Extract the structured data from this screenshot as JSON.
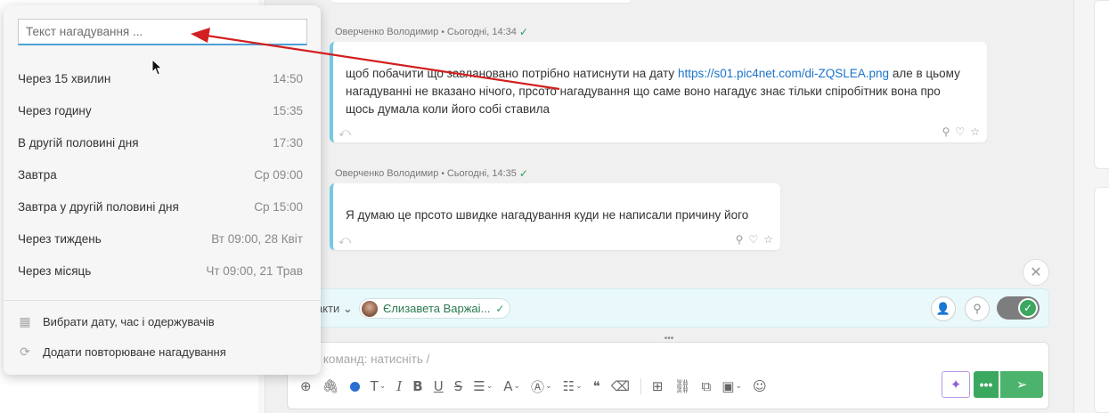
{
  "reminder_popup": {
    "input_placeholder": "Текст нагадування ...",
    "options": [
      {
        "label": "Через 15 хвилин",
        "time": "14:50"
      },
      {
        "label": "Через годину",
        "time": "15:35"
      },
      {
        "label": "В другій половині дня",
        "time": "17:30"
      },
      {
        "label": "Завтра",
        "time": "Ср 09:00"
      },
      {
        "label": "Завтра у другій половині дня",
        "time": "Ср 15:00"
      },
      {
        "label": "Через тиждень",
        "time": "Вт 09:00, 28 Квіт"
      },
      {
        "label": "Через місяць",
        "time": "Чт 09:00, 21 Трав"
      }
    ],
    "actions": [
      {
        "label": "Вибрати дату, час і одержувачів",
        "icon": "calendar-icon"
      },
      {
        "label": "Додати повторюване нагадування",
        "icon": "repeat-icon"
      }
    ]
  },
  "messages": [
    {
      "author": "Оверченко Володимир",
      "time": "Сьогодні, 14:34",
      "text_before_link": "щоб побачити що завлановано потрібно натиснути на дату ",
      "link": "https://s01.pic4net.com/di-ZQSLEA.png",
      "text_after_link": " але в цьому нагадуванні не вказано нічого, прсото нагадування що саме воно нагадує знає тільки спіробітник вона про щось думала коли його собі ставила"
    },
    {
      "author": "Оверченко Володимир",
      "time": "Сьогодні, 14:35",
      "text": "Я думаю це прсото швидке нагадування куди не написали причину його"
    }
  ],
  "compose": {
    "recipients_label": "акти",
    "recipient_name": "Єлизавета Варжаі...",
    "input_placeholder": "ю команд: натисніть /"
  },
  "icons": {
    "close": "close-icon",
    "reply": "reply-icon",
    "pin": "pin-icon",
    "like": "heart-icon",
    "favorite": "star-icon",
    "send": "send-icon"
  },
  "colors": {
    "accent_green": "#3aa85f",
    "bubble_border": "#76c9e3",
    "link": "#1a73c9",
    "arrow": "#d21f1f"
  }
}
